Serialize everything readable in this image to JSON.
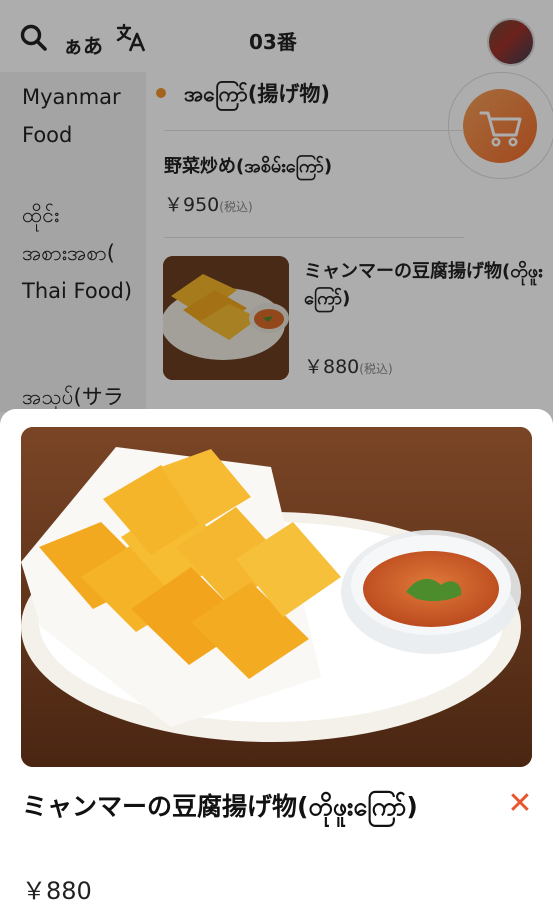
{
  "header": {
    "kana_label": "ぁあ",
    "table_number": "03番"
  },
  "sidebar": {
    "items": [
      {
        "label": "Myanmar Food"
      },
      {
        "label": "ထိုင်း အစားအစာ( Thai Food)"
      },
      {
        "label": "အသုပ်(サラ"
      }
    ]
  },
  "category": {
    "title": "အကြော်(揚げ物)"
  },
  "menu_items": [
    {
      "name": "野菜炒め(အစိမ်းကြော်)",
      "price": "￥950",
      "tax_note": "(税込)"
    },
    {
      "name": "ミャンマーの豆腐揚げ物(တိုဖူးကြော်)",
      "price": "￥880",
      "tax_note": "(税込)"
    }
  ],
  "detail": {
    "title": "ミャンマーの豆腐揚げ物(တိုဖူးကြော်)",
    "price": "￥880",
    "close_label": "✕"
  },
  "colors": {
    "accent": "#ef6b2c",
    "accent_light": "#f5a05a",
    "dot": "#f0942e",
    "close": "#e8552e"
  },
  "icons": [
    "search-icon",
    "translate-icon",
    "cart-icon",
    "close-icon"
  ]
}
